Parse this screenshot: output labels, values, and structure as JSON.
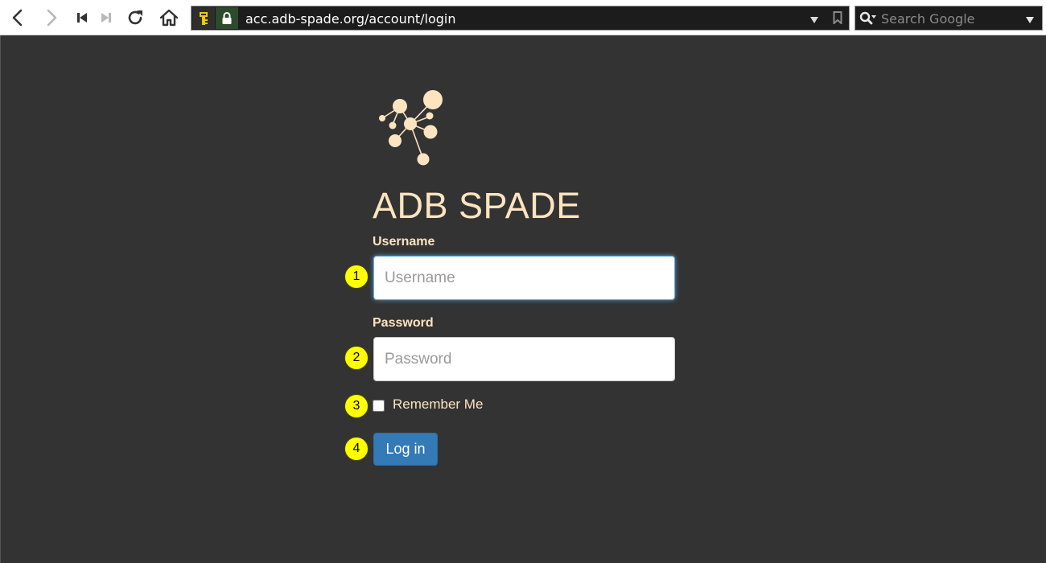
{
  "browser": {
    "url": "acc.adb-spade.org/account/login",
    "search_placeholder": "Search Google"
  },
  "page": {
    "brand_title": "ADB SPADE",
    "username_label": "Username",
    "username_placeholder": "Username",
    "username_value": "",
    "password_label": "Password",
    "password_placeholder": "Password",
    "password_value": "",
    "remember_label": "Remember Me",
    "remember_checked": false,
    "login_label": "Log in"
  },
  "annotations": [
    "1",
    "2",
    "3",
    "4"
  ],
  "colors": {
    "page_background": "#333333",
    "brand_text": "#fde4c0",
    "button_primary": "#337ab7",
    "callout": "#ffff00",
    "urlbar_background": "#1c1c1c"
  },
  "icons": {
    "back": "chevron-left-icon",
    "forward": "chevron-right-icon",
    "first": "skip-back-icon",
    "last": "skip-forward-icon",
    "reload": "reload-icon",
    "home": "home-icon",
    "key": "key-icon",
    "lock": "lock-icon",
    "bookmark": "bookmark-icon",
    "search": "search-icon",
    "logo": "molecule-logo-icon"
  }
}
